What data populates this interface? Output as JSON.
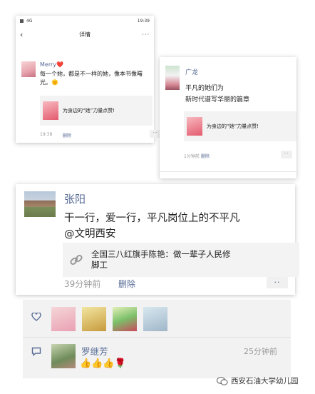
{
  "card1": {
    "statusbar": {
      "left": "4G",
      "time": "19:39"
    },
    "nav": {
      "back": "‹",
      "title": "详情",
      "more": "···"
    },
    "post": {
      "author": "Merry❤️",
      "text_line1": "每一个她，都是不一样的她，像本书像曙",
      "text_line2": "光。🌞",
      "share_text": "为身边的“她”力量点赞!",
      "time": "19:38",
      "delete": "删除",
      "more": "··"
    }
  },
  "card2": {
    "post": {
      "author": "广龙",
      "line1": "平凡的她们为",
      "line2": "新时代谱写华丽的篇章",
      "share_text": "为身边的“她”力量点赞!",
      "time": "1分钟前",
      "delete": "删除",
      "more": "··"
    }
  },
  "main": {
    "author": "张阳",
    "text_line1": "干一行，爱一行，平凡岗位上的不平凡",
    "text_line2": "@文明西安",
    "link_line1": "全国三八红旗手陈艳：做一辈子人民修",
    "link_line2": "脚工",
    "time": "39分钟前",
    "delete": "删除",
    "more": "··"
  },
  "bottom": {
    "like_icon": "heart-icon",
    "comment_icon": "comment-icon",
    "commenter": "罗继芳",
    "comment_time": "25分钟前",
    "comment_text": "👍👍👍🌹"
  },
  "watermark": "西安石油大学幼儿园",
  "colors": {
    "link_blue": "#576b95",
    "meta_gray": "#9a9a9a",
    "panel_bg": "#f2f2f2"
  }
}
